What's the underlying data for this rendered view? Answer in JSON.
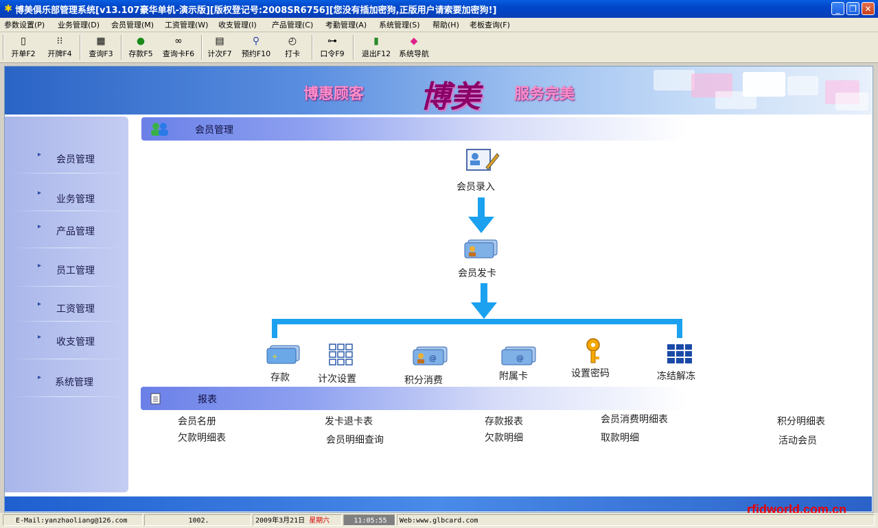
{
  "window": {
    "title": "博美俱乐部管理系统[v13.107豪华单机-演示版][版权登记号:2008SR6756][您没有插加密狗,正版用户请索要加密狗!]"
  },
  "menu": [
    "参数设置(P)",
    "业务管理(D)",
    "会员管理(M)",
    "工资管理(W)",
    "收支管理(I)",
    "产品管理(C)",
    "考勤管理(A)",
    "系统管理(S)",
    "帮助(H)",
    "老板查询(F)"
  ],
  "toolbar": [
    {
      "label": "开单F2",
      "icon": "door-icon"
    },
    {
      "label": "开牌F4",
      "icon": "grid-icon"
    },
    {
      "label": "查询F3",
      "icon": "query-icon"
    },
    {
      "label": "存款F5",
      "icon": "money-bag-icon"
    },
    {
      "label": "查询卡F6",
      "icon": "binoculars-icon"
    },
    {
      "label": "计次F7",
      "icon": "counter-icon"
    },
    {
      "label": "预约F10",
      "icon": "bicycle-icon"
    },
    {
      "label": "打卡",
      "icon": "clock-icon"
    },
    {
      "label": "口令F9",
      "icon": "key-icon"
    },
    {
      "label": "退出F12",
      "icon": "exit-icon"
    },
    {
      "label": "系统导航",
      "icon": "nav-icon"
    }
  ],
  "banner": {
    "left": "博惠顾客",
    "logo": "博美",
    "right": "服务完美"
  },
  "sidebar": [
    "会员管理",
    "业务管理",
    "产品管理",
    "员工管理",
    "工资管理",
    "收支管理",
    "系统管理"
  ],
  "section1": {
    "title": "会员管理"
  },
  "flow": {
    "step1": "会员录入",
    "step2": "会员发卡",
    "branches": [
      "存款",
      "计次设置",
      "积分消费",
      "附属卡",
      "设置密码",
      "冻结解冻"
    ]
  },
  "section2": {
    "title": "报表"
  },
  "reports": {
    "row1": [
      "会员名册",
      "发卡退卡表",
      "存款报表",
      "会员消费明细表",
      "积分明细表"
    ],
    "row2": [
      "欠款明细表",
      "会员明细查询",
      "欠款明细",
      "取款明细",
      "活动会员"
    ]
  },
  "status": {
    "email": "E-Mail:yanzhaoliang@126.com",
    "code": "1002.",
    "date": "2009年3月21日",
    "weekday": "星期六",
    "time": "11:05:55",
    "web": "Web:www.glbcard.com"
  },
  "watermark": "rfidworld.com.cn",
  "colors": {
    "accent": "#0a5de0",
    "arrow": "#1ba1f0",
    "weekday": "#d00000",
    "watermark": "#ee0000"
  }
}
